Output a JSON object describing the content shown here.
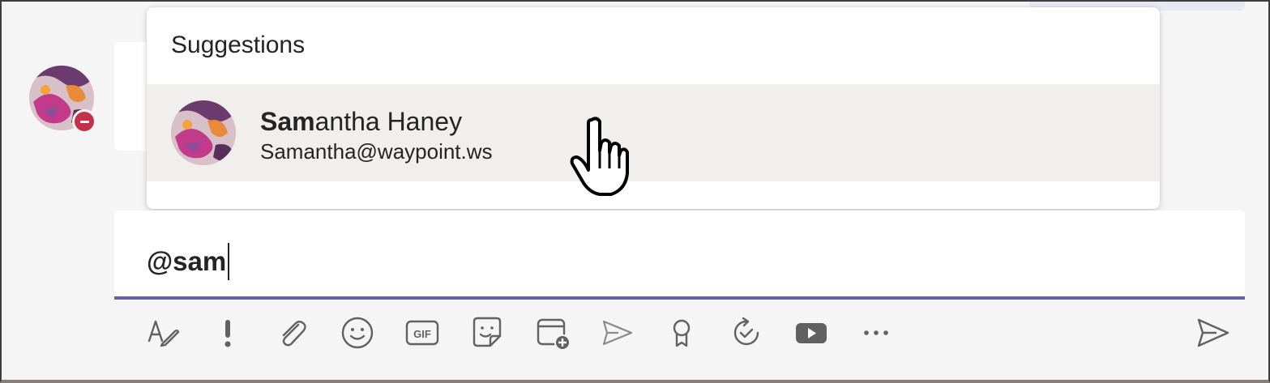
{
  "suggestions": {
    "header": "Suggestions",
    "items": [
      {
        "name_match": "Sam",
        "name_rest": "antha Haney",
        "email": "Samantha@waypoint.ws"
      }
    ]
  },
  "compose": {
    "value": "@sam"
  },
  "presence": {
    "status": "do-not-disturb",
    "color": "#c4314b"
  },
  "colors": {
    "accent": "#6264a7",
    "highlight": "#f0efee"
  },
  "toolbar": {
    "icons": [
      "format-icon",
      "important-icon",
      "attach-icon",
      "emoji-icon",
      "gif-icon",
      "sticker-icon",
      "schedule-meeting-icon",
      "stream-icon",
      "praise-icon",
      "loop-icon",
      "video-icon",
      "more-icon",
      "send-icon"
    ]
  }
}
